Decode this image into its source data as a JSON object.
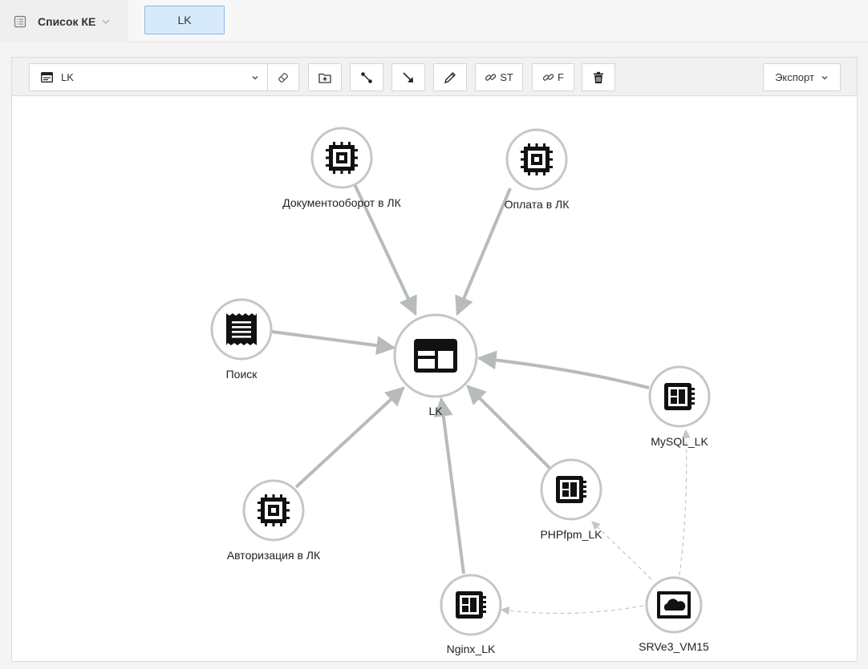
{
  "header": {
    "ke_list_label": "Список КЕ",
    "tab_label": "LK"
  },
  "toolbar": {
    "graph_select_value": "LK",
    "st_label": "ST",
    "f_label": "F",
    "export_label": "Экспорт"
  },
  "graph": {
    "center": {
      "label": "LK",
      "icon": "app-window-icon"
    },
    "nodes": [
      {
        "id": "doc",
        "label": "Документооборот в ЛК",
        "icon": "chip-icon"
      },
      {
        "id": "pay",
        "label": "Оплата в ЛК",
        "icon": "chip-icon"
      },
      {
        "id": "search",
        "label": "Поиск",
        "icon": "receipt-icon"
      },
      {
        "id": "auth",
        "label": "Авторизация в ЛК",
        "icon": "chip-icon"
      },
      {
        "id": "nginx",
        "label": "Nginx_LK",
        "icon": "server-module-icon"
      },
      {
        "id": "php",
        "label": "PHPfpm_LK",
        "icon": "server-module-icon"
      },
      {
        "id": "mysql",
        "label": "MySQL_LK",
        "icon": "server-module-icon"
      },
      {
        "id": "srv",
        "label": "SRVe3_VM15",
        "icon": "cloud-vm-icon"
      }
    ],
    "edges": [
      {
        "from": "doc",
        "to": "lk",
        "style": "solid"
      },
      {
        "from": "pay",
        "to": "lk",
        "style": "solid"
      },
      {
        "from": "search",
        "to": "lk",
        "style": "solid"
      },
      {
        "from": "auth",
        "to": "lk",
        "style": "solid"
      },
      {
        "from": "nginx",
        "to": "lk",
        "style": "solid"
      },
      {
        "from": "php",
        "to": "lk",
        "style": "solid"
      },
      {
        "from": "mysql",
        "to": "lk",
        "style": "solid"
      },
      {
        "from": "srv",
        "to": "nginx",
        "style": "dashed"
      },
      {
        "from": "srv",
        "to": "php",
        "style": "dashed"
      },
      {
        "from": "srv",
        "to": "mysql",
        "style": "dashed"
      }
    ]
  }
}
